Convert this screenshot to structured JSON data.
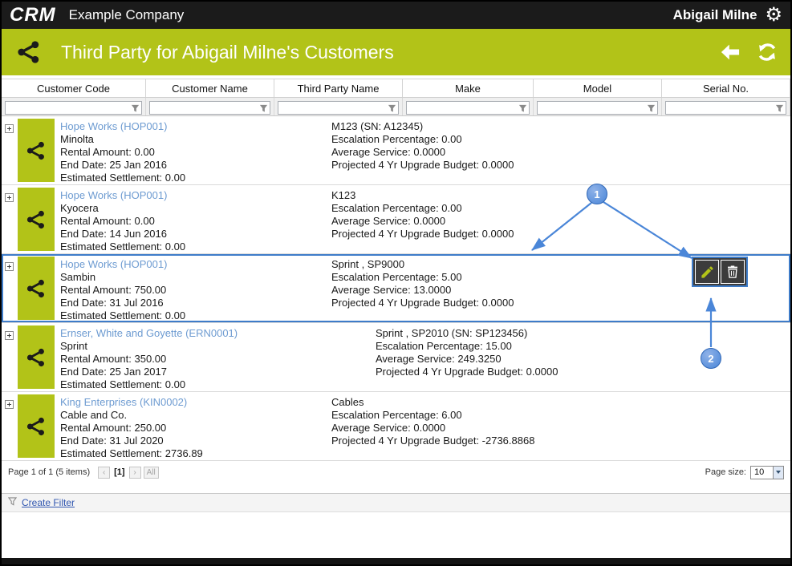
{
  "topbar": {
    "logo": "CRM",
    "company": "Example Company",
    "user": "Abigail Milne"
  },
  "header": {
    "title": "Third Party for Abigail Milne's Customers"
  },
  "grid": {
    "columns": [
      "Customer Code",
      "Customer Name",
      "Third Party Name",
      "Make",
      "Model",
      "Serial No."
    ],
    "rows": [
      {
        "customer": "Hope Works (HOP001)",
        "details": [
          "Minolta",
          "Rental Amount: 0.00",
          "End Date: 25 Jan 2016",
          "Estimated Settlement: 0.00"
        ],
        "third_party": [
          "M123 (SN: A12345)",
          "Escalation Percentage: 0.00",
          "Average Service: 0.0000",
          "Projected 4 Yr Upgrade Budget: 0.0000"
        ]
      },
      {
        "customer": "Hope Works (HOP001)",
        "details": [
          "Kyocera",
          "Rental Amount: 0.00",
          "End Date: 14 Jun 2016",
          "Estimated Settlement: 0.00"
        ],
        "third_party": [
          "K123",
          "Escalation Percentage: 0.00",
          "Average Service: 0.0000",
          "Projected 4 Yr Upgrade Budget: 0.0000"
        ]
      },
      {
        "customer": "Hope Works (HOP001)",
        "details": [
          "Sambin",
          "Rental Amount: 750.00",
          "End Date: 31 Jul 2016",
          "Estimated Settlement: 0.00"
        ],
        "third_party": [
          "Sprint , SP9000",
          "Escalation Percentage: 5.00",
          "Average Service: 13.0000",
          "Projected 4 Yr Upgrade Budget: 0.0000"
        ]
      },
      {
        "customer": "Ernser, White and Goyette (ERN0001)",
        "details": [
          "Sprint",
          "Rental Amount: 350.00",
          "End Date: 25 Jan 2017",
          "Estimated Settlement: 0.00"
        ],
        "third_party": [
          "Sprint , SP2010 (SN: SP123456)",
          "Escalation Percentage: 15.00",
          "Average Service: 249.3250",
          "Projected 4 Yr Upgrade Budget: 0.0000"
        ]
      },
      {
        "customer": "King Enterprises (KIN0002)",
        "details": [
          "Cable and Co.",
          "Rental Amount: 250.00",
          "End Date: 31 Jul 2020",
          "Estimated Settlement: 2736.89"
        ],
        "third_party": [
          "Cables",
          "Escalation Percentage: 6.00",
          "Average Service: 0.0000",
          "Projected 4 Yr Upgrade Budget: -2736.8868"
        ]
      }
    ]
  },
  "pager": {
    "summary": "Page 1 of 1 (5 items)",
    "prev_icon": "‹",
    "current_page": "[1]",
    "next_icon": "›",
    "all_label": "All",
    "page_size_label": "Page size:",
    "page_size_value": "10"
  },
  "footer": {
    "create_filter_label": "Create Filter"
  },
  "annotations": {
    "callout_1": "1",
    "callout_2": "2"
  },
  "colors": {
    "accent_green": "#b2c318",
    "selection_blue": "#3e7cc9",
    "link_blue": "#6d9bd1",
    "annotation_blue": "#4a86d8",
    "topbar_black": "#1b1b1b"
  }
}
